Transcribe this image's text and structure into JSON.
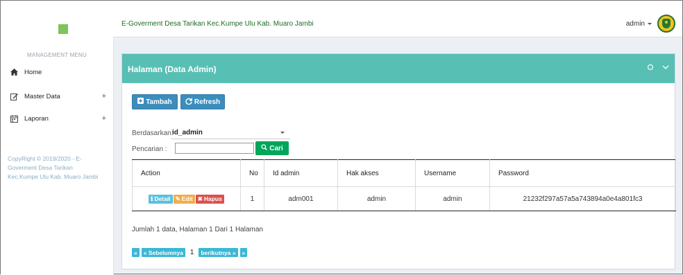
{
  "sidebar": {
    "menu_header": "MANAGEMENT MENU",
    "items": [
      {
        "label": "Home",
        "icon": "home-icon",
        "expandable": false
      },
      {
        "label": "Master Data",
        "icon": "edit-icon",
        "expandable": true
      },
      {
        "label": "Laporan",
        "icon": "calendar-icon",
        "expandable": true
      }
    ],
    "expand_symbol": "+",
    "copyright": "CopyRight © 2019/2020 - E-Goverment Desa Tarikan Kec.Kumpe Ulu Kab. Muaro Jambi"
  },
  "topbar": {
    "title": "E-Goverment Desa Tarikan Kec.Kumpe Ulu Kab. Muaro Jambi",
    "user": "admin"
  },
  "panel": {
    "title": "Halaman (Data Admin)",
    "tambah_label": "Tambah",
    "refresh_label": "Refresh",
    "berdasarkan_label": "Berdasarkan:",
    "berdasarkan_value": "id_admin",
    "pencarian_label": "Pencarian",
    "search_value": "",
    "cari_label": "Cari"
  },
  "table": {
    "headers": [
      "Action",
      "No",
      "Id admin",
      "Hak akses",
      "Username",
      "Password"
    ],
    "rows": [
      {
        "no": "1",
        "id_admin": "adm001",
        "hak_akses": "admin",
        "username": "admin",
        "password": "21232f297a57a5a743894a0e4a801fc3"
      }
    ],
    "action_labels": {
      "detail": "Detail",
      "edit": "Edit",
      "hapus": "Hapus"
    }
  },
  "footer": {
    "info": "Jumlah 1 data, Halaman 1 Dari 1 Halaman",
    "first": "«",
    "prev": "« Sebelumnya",
    "page": "1",
    "next": "berikutnya »",
    "last": "»"
  },
  "colors": {
    "accent_teal": "#58bfb4",
    "primary": "#3c8dbc",
    "success": "#00a65a",
    "title_green": "#1e6b22"
  }
}
